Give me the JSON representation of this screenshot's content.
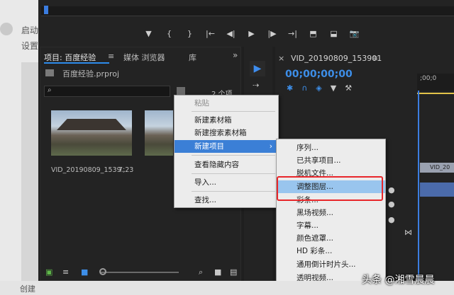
{
  "background_page": {
    "text_1": "启动",
    "text_2": "设置",
    "bottom_text": "创建"
  },
  "program_controls": [
    "▼",
    "{",
    "}",
    "|←",
    "◀|",
    "▶",
    "|▶",
    "→|",
    "⬒",
    "⬓",
    "📷"
  ],
  "project_panel": {
    "tabs": [
      "项目: 百度经验",
      "媒体 浏览器",
      "库"
    ],
    "tab_menu_icon": "≡",
    "overflow_icon": "»",
    "file_name": "百度经验.prproj",
    "item_count": "2 个项",
    "search_placeholder": "",
    "clip_name": "VID_20190809_1539...",
    "clip_duration": "7;23"
  },
  "timeline": {
    "close_icon": "×",
    "sequence_title": "VID_20190809_153901",
    "menu_icon": "≡",
    "timecode": "00;00;00;00",
    "ruler_time": ";00;0",
    "clip_label": "VID_20"
  },
  "context_menu": {
    "items": [
      {
        "label": "粘贴",
        "disabled": true
      },
      {
        "label": "新建素材箱",
        "disabled": false
      },
      {
        "label": "新建搜索素材箱",
        "disabled": false
      },
      {
        "label": "新建项目",
        "disabled": false,
        "highlighted": true,
        "submenu_arrow": "›"
      },
      {
        "label": "查看隐藏内容",
        "disabled": false
      },
      {
        "label": "导入...",
        "disabled": false
      },
      {
        "label": "查找...",
        "disabled": false
      }
    ]
  },
  "submenu": {
    "items": [
      {
        "label": "序列..."
      },
      {
        "label": "已共享项目..."
      },
      {
        "label": "脱机文件..."
      },
      {
        "label": "调整图层...",
        "highlighted": true
      },
      {
        "label": "彩条..."
      },
      {
        "label": "黑场视频..."
      },
      {
        "label": "字幕..."
      },
      {
        "label": "颜色遮罩..."
      },
      {
        "label": "HD 彩条..."
      },
      {
        "label": "通用倒计时片头..."
      },
      {
        "label": "透明视频..."
      }
    ]
  },
  "watermark": "头条 @湘雪晨晨",
  "colors": {
    "accent": "#3d8ee8",
    "highlight_box": "#e8262a",
    "menu_highlight": "#3b7fd6"
  }
}
